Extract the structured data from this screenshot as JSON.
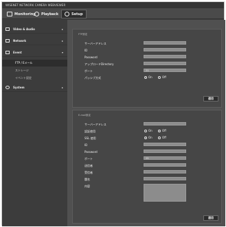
{
  "window": {
    "title": "WISENET NETWORK CAMERA WEBVIEWER"
  },
  "tabs": [
    {
      "label": "Monitoring",
      "icon": "monitor-icon"
    },
    {
      "label": "Playback",
      "icon": "playback-icon"
    },
    {
      "label": "Setup",
      "icon": "gear-icon"
    }
  ],
  "sidebar": {
    "menus": [
      {
        "label": "Video & Audio",
        "icon": "video-audio-icon"
      },
      {
        "label": "Network",
        "icon": "network-icon"
      },
      {
        "label": "Event",
        "icon": "event-icon"
      }
    ],
    "event_items": [
      {
        "label": "FTP / Eメール"
      },
      {
        "label": "ストレージ"
      },
      {
        "label": "イベント設定"
      }
    ],
    "system": {
      "label": "System",
      "icon": "system-gear-icon"
    }
  },
  "ftp": {
    "title": "FTP設定",
    "server_label": "サーバーアドレス",
    "id_label": "ID",
    "password_label": "Password",
    "upload_dir_label": "アップロードDirectory",
    "port_label": "ポート",
    "port_value": "21",
    "passive_label": "パッシブ方式",
    "passive_on": "On",
    "passive_off": "Off",
    "apply_label": "適用"
  },
  "email": {
    "title": "E-mail設定",
    "server_label": "サーバーアドレス",
    "auth_label": "認証使用",
    "auth_on": "On",
    "auth_off": "Off",
    "ssl_label": "SSL 使用",
    "ssl_on": "On",
    "ssl_off": "Off",
    "id_label": "ID",
    "password_label": "Password",
    "port_label": "ポート",
    "port_value": "25",
    "sender_label": "送信者",
    "recipient_label": "受信者",
    "subject_label": "題名",
    "body_label": "内容",
    "apply_label": "適用"
  }
}
